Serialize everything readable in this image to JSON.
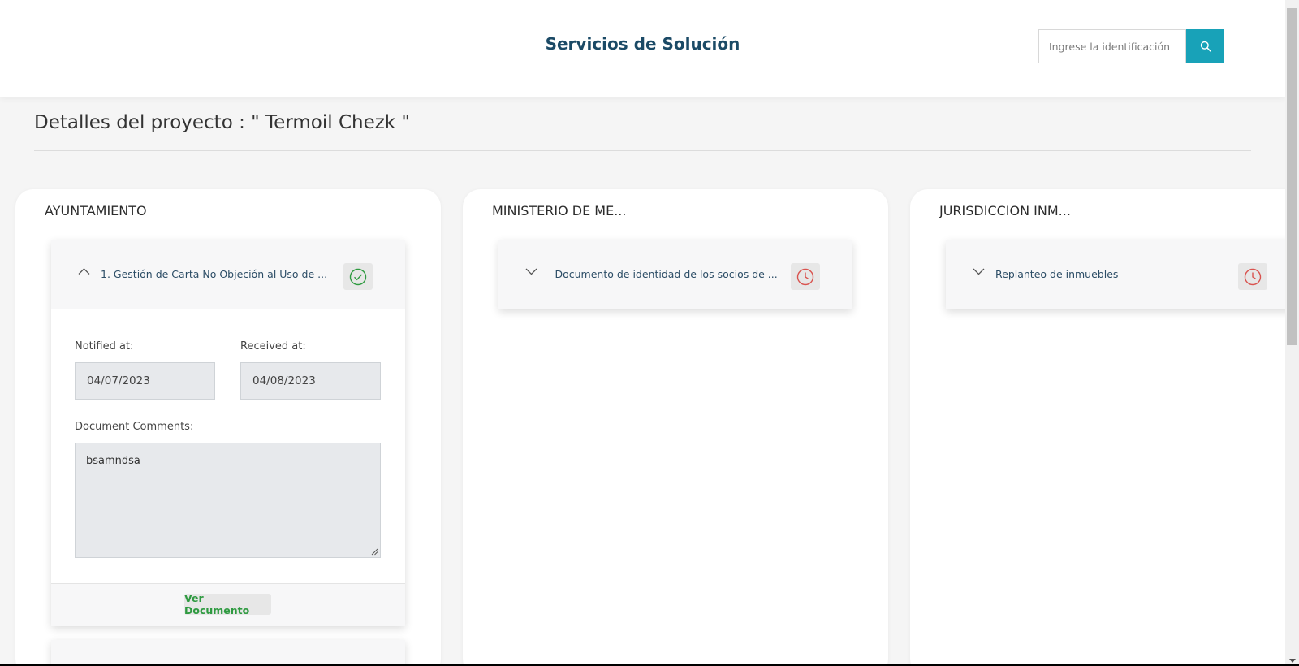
{
  "header": {
    "title": "Servicios de Solución",
    "search_placeholder": "Ingrese la identificación"
  },
  "page": {
    "title": "Detalles del proyecto : \" Termoil Chezk \""
  },
  "columns": [
    {
      "title": "AYUNTAMIENTO",
      "card": {
        "label": "1. Gestión de Carta No Objeción al Uso de ...",
        "status": "completed",
        "status_icon": "check-circle-icon",
        "notified_label": "Notified at:",
        "notified_value": "04/07/2023",
        "received_label": "Received at:",
        "received_value": "04/08/2023",
        "comments_label": "Document Comments:",
        "comments_value": "bsamndsa",
        "view_button": "Ver Documento"
      }
    },
    {
      "title": "MINISTERIO DE ME...",
      "card": {
        "label": "- Documento de identidad de los socios de ...",
        "status": "pending",
        "status_icon": "clock-icon"
      }
    },
    {
      "title": "JURISDICCION INM...",
      "card": {
        "label": "Replanteo de inmuebles",
        "status": "pending",
        "status_icon": "clock-icon"
      }
    }
  ],
  "colors": {
    "accent": "#18a2b8",
    "title": "#1b4a66",
    "success": "#2e9a40",
    "pending": "#d9534f"
  }
}
